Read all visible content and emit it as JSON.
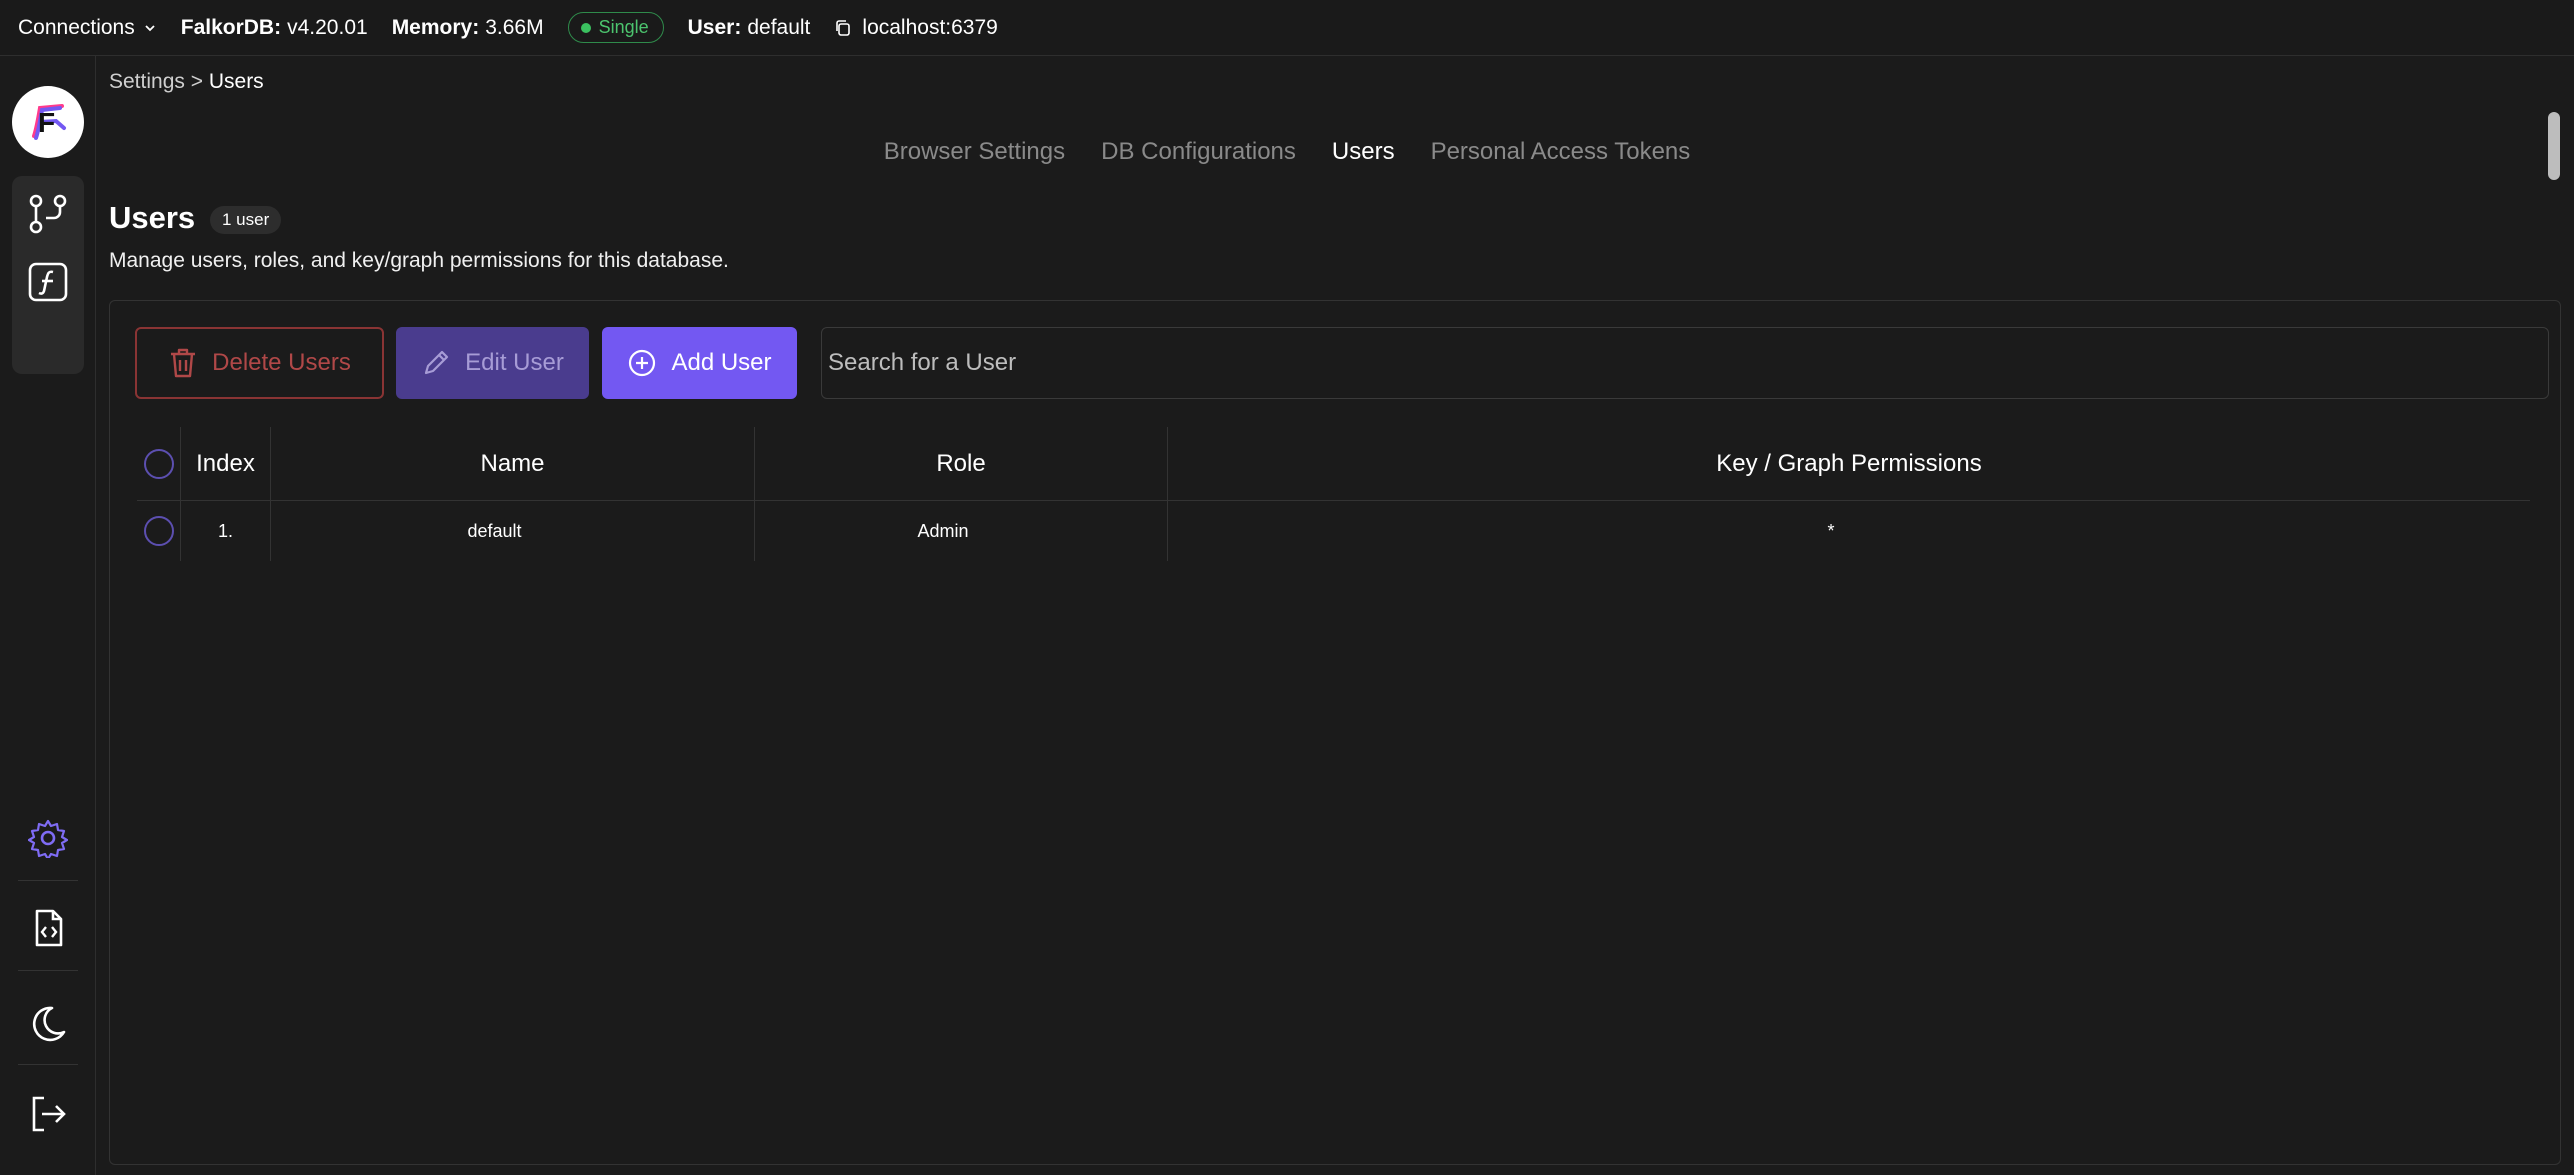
{
  "topbar": {
    "connections_label": "Connections",
    "db_key": "FalkorDB:",
    "db_value": "v4.20.01",
    "memory_key": "Memory:",
    "memory_value": "3.66M",
    "mode_badge": "Single",
    "user_key": "User:",
    "user_value": "default",
    "host": "localhost:6379"
  },
  "sidebar": {
    "logo_letter": "F",
    "nav_items": [
      "graph-schema-icon",
      "function-icon"
    ],
    "bottom_items": [
      "settings-icon",
      "docs-icon",
      "theme-icon",
      "logout-icon"
    ]
  },
  "breadcrumb": {
    "parent": "Settings",
    "separator": ">",
    "current": "Users"
  },
  "tabs": [
    {
      "label": "Browser Settings",
      "active": false
    },
    {
      "label": "DB Configurations",
      "active": false
    },
    {
      "label": "Users",
      "active": true
    },
    {
      "label": "Personal Access Tokens",
      "active": false
    }
  ],
  "page": {
    "title": "Users",
    "count_badge": "1 user",
    "subtitle": "Manage users, roles, and key/graph permissions for this database."
  },
  "toolbar": {
    "delete_label": "Delete Users",
    "edit_label": "Edit User",
    "add_label": "Add User",
    "search_placeholder": "Search for a User"
  },
  "table": {
    "headers": {
      "index": "Index",
      "name": "Name",
      "role": "Role",
      "permissions": "Key / Graph Permissions"
    },
    "rows": [
      {
        "index": "1.",
        "name": "default",
        "role": "Admin",
        "permissions": "*"
      }
    ]
  },
  "colors": {
    "accent": "#7358f2",
    "danger": "#b04848",
    "success": "#3bc160",
    "background": "#1b1b1b"
  }
}
